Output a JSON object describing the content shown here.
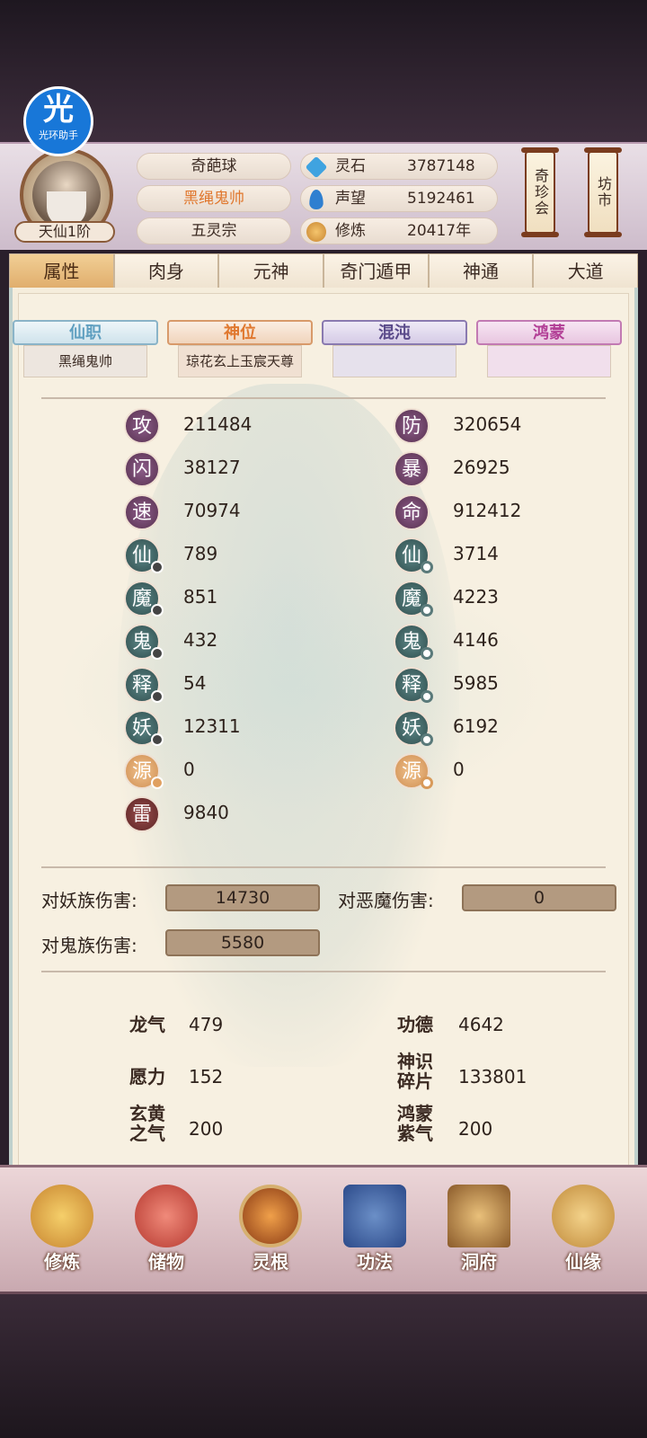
{
  "profile": {
    "halo_icon_text": "光",
    "halo_label": "光环助手",
    "rank": "天仙1阶",
    "name": "奇葩球",
    "title": "黑绳鬼帅",
    "sect": "五灵宗"
  },
  "resources": [
    {
      "label": "灵石",
      "value": "3787148",
      "icon": "blue-gem-icon",
      "color": "#3fa3e0"
    },
    {
      "label": "声望",
      "value": "5192461",
      "icon": "blue-crystal-icon",
      "color": "#2f7fd0"
    },
    {
      "label": "修炼",
      "value": "20417年",
      "icon": "meditation-icon",
      "color": "#d99b4a"
    }
  ],
  "side_buttons": [
    "奇珍会",
    "坊市"
  ],
  "tabs": [
    "属性",
    "肉身",
    "元神",
    "奇门遁甲",
    "神通",
    "大道"
  ],
  "active_tab": "属性",
  "sub_tabs": [
    {
      "label": "仙职",
      "value": "黑绳鬼帅",
      "color": "#5f9fc0"
    },
    {
      "label": "神位",
      "value": "琼花玄上玉宸天尊",
      "color": "#e0782f"
    },
    {
      "label": "混沌",
      "value": "",
      "color": "#5a4a8a"
    },
    {
      "label": "鸿蒙",
      "value": "",
      "color": "#b23f96"
    }
  ],
  "stats_left": [
    {
      "icon": "攻",
      "value": "211484"
    },
    {
      "icon": "闪",
      "value": "38127"
    },
    {
      "icon": "速",
      "value": "70974"
    },
    {
      "icon": "仙",
      "value": "789"
    },
    {
      "icon": "魔",
      "value": "851"
    },
    {
      "icon": "鬼",
      "value": "432"
    },
    {
      "icon": "释",
      "value": "54"
    },
    {
      "icon": "妖",
      "value": "12311"
    },
    {
      "icon": "源",
      "value": "0"
    },
    {
      "icon": "雷",
      "value": "9840"
    }
  ],
  "stats_right": [
    {
      "icon": "防",
      "value": "320654"
    },
    {
      "icon": "暴",
      "value": "26925"
    },
    {
      "icon": "命",
      "value": "912412"
    },
    {
      "icon": "仙",
      "value": "3714"
    },
    {
      "icon": "魔",
      "value": "4223"
    },
    {
      "icon": "鬼",
      "value": "4146"
    },
    {
      "icon": "释",
      "value": "5985"
    },
    {
      "icon": "妖",
      "value": "6192"
    },
    {
      "icon": "源",
      "value": "0"
    }
  ],
  "damage": {
    "vs_demon_clan_label": "对妖族伤害:",
    "vs_demon_clan_value": "14730",
    "vs_evil_label": "对恶魔伤害:",
    "vs_evil_value": "0",
    "vs_ghost_label": "对鬼族伤害:",
    "vs_ghost_value": "5580"
  },
  "special_stats": [
    {
      "label": "龙气",
      "value": "479"
    },
    {
      "label": "功德",
      "value": "4642"
    },
    {
      "label": "愿力",
      "value": "152"
    },
    {
      "label": "神识碎片",
      "value": "133801"
    },
    {
      "label": "玄黄之气",
      "value": "200"
    },
    {
      "label": "鸿蒙紫气",
      "value": "200"
    }
  ],
  "nav": [
    {
      "label": "修炼",
      "icon": "cultivation-icon"
    },
    {
      "label": "储物",
      "icon": "storage-bag-icon"
    },
    {
      "label": "灵根",
      "icon": "spirit-root-icon"
    },
    {
      "label": "功法",
      "icon": "technique-book-icon"
    },
    {
      "label": "洞府",
      "icon": "cave-dwelling-icon"
    },
    {
      "label": "仙缘",
      "icon": "immortal-fate-icon"
    }
  ]
}
